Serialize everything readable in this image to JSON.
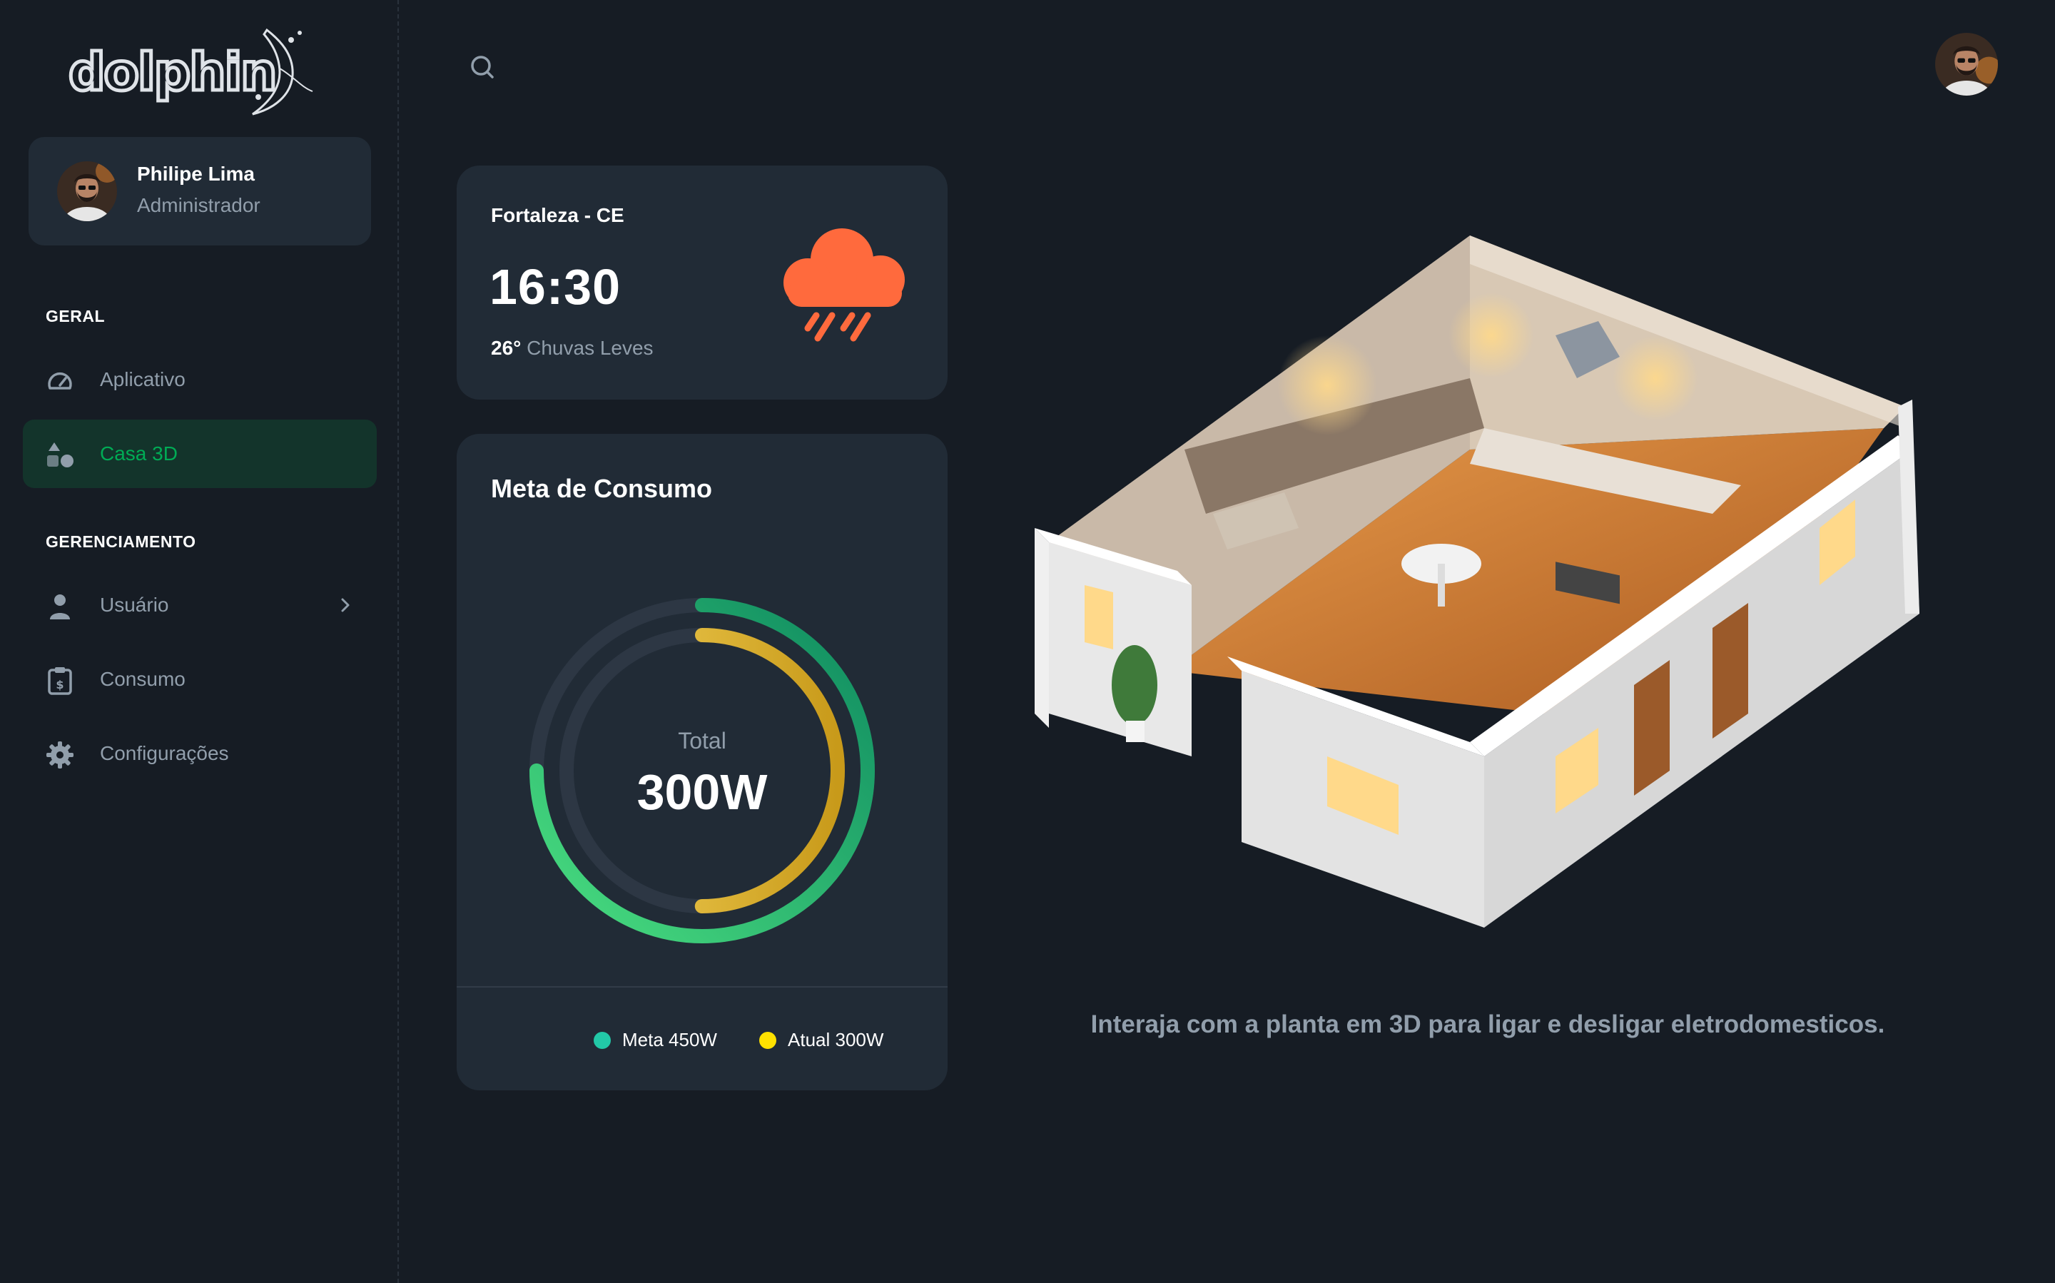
{
  "brand": {
    "name": "dolphin"
  },
  "user": {
    "name": "Philipe Lima",
    "role": "Administrador"
  },
  "sidebar": {
    "section_general": "GERAL",
    "general_items": [
      {
        "label": "Aplicativo",
        "icon": "speedometer-icon"
      },
      {
        "label": "Casa 3D",
        "icon": "shapes-icon",
        "active": true
      }
    ],
    "section_management": "GERENCIAMENTO",
    "management_items": [
      {
        "label": "Usuário",
        "icon": "user-icon"
      },
      {
        "label": "Consumo",
        "icon": "receipt-icon"
      },
      {
        "label": "Configurações",
        "icon": "gear-icon"
      }
    ]
  },
  "weather": {
    "city": "Fortaleza - CE",
    "time": "16:30",
    "temperature": "26°",
    "condition": "Chuvas Leves",
    "icon": "cloud-rain-icon"
  },
  "consumption": {
    "title": "Meta de Consumo",
    "total_label": "Total",
    "total_value": "300W",
    "goal_fraction": 0.75,
    "current_fraction": 0.5,
    "legend": [
      {
        "label": "Meta 450W",
        "color": "#22c8a7"
      },
      {
        "label": "Atual 300W",
        "color": "#ffe100"
      }
    ]
  },
  "hint": "Interaja com a planta em 3D para ligar e desligar eletrodomesticos.",
  "colors": {
    "background": "#161c24",
    "card": "#212b36",
    "accent_green": "#00ab55",
    "weather_orange": "#ff6a3d",
    "muted_text": "#919eab"
  }
}
